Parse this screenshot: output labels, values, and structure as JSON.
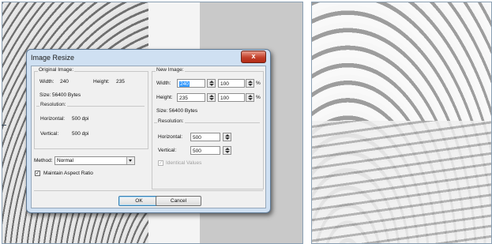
{
  "dialog": {
    "title": "Image Resize",
    "close_label": "x",
    "original": {
      "legend": "Original Image:",
      "width_label": "Width:",
      "width_value": "240",
      "height_label": "Height:",
      "height_value": "235",
      "size_label": "Size:",
      "size_value": "56400 Bytes",
      "resolution": {
        "legend": "Resolution:",
        "horizontal_label": "Horizontal:",
        "horizontal_value": "500 dpi",
        "vertical_label": "Vertical:",
        "vertical_value": "500 dpi"
      }
    },
    "new": {
      "legend": "New Image:",
      "width_label": "Width:",
      "width_value": "240",
      "width_percent": "100",
      "height_label": "Height:",
      "height_value": "235",
      "height_percent": "100",
      "percent_unit": "%",
      "size_label": "Size:",
      "size_value": "56400 Bytes",
      "resolution": {
        "legend": "Resolution:",
        "horizontal_label": "Horizontal:",
        "horizontal_value": "500",
        "vertical_label": "Vertical:",
        "vertical_value": "500",
        "identical_label": "Identical Values",
        "identical_checked": true
      }
    },
    "method_label": "Method:",
    "method_value": "Normal",
    "maintain_aspect_label": "Maintain Aspect Ratio",
    "maintain_aspect_checked": true,
    "check_mark": "✓",
    "ok_label": "OK",
    "cancel_label": "Cancel"
  }
}
